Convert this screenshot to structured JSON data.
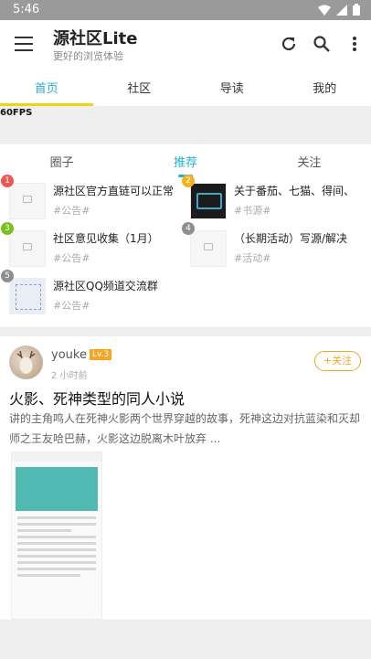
{
  "statusbar": {
    "time": "5:46",
    "icons": [
      "wifi-icon",
      "signal-icon",
      "battery-icon"
    ]
  },
  "appbar": {
    "title": "源社区Lite",
    "subtitle": "更好的浏览体验",
    "actions": [
      "refresh-icon",
      "search-icon",
      "more-vertical-icon"
    ]
  },
  "tabs": [
    {
      "label": "首页",
      "active": true
    },
    {
      "label": "社区",
      "active": false
    },
    {
      "label": "导读",
      "active": false
    },
    {
      "label": "我的",
      "active": false
    }
  ],
  "fps": "60FPS",
  "subtabs": [
    {
      "label": "圈子",
      "active": false
    },
    {
      "label": "推荐",
      "active": true
    },
    {
      "label": "关注",
      "active": false
    }
  ],
  "recommend": [
    {
      "rank": "1",
      "title": "源社区官方直链可以正常",
      "tag": "#公告#"
    },
    {
      "rank": "2",
      "title": "关于番茄、七猫、得间、",
      "tag": "#书源#"
    },
    {
      "rank": "3",
      "title": "社区意见收集（1月）",
      "tag": "#公告#"
    },
    {
      "rank": "4",
      "title": "（长期活动）写源/解决",
      "tag": "#活动#"
    },
    {
      "rank": "5",
      "title": "源社区QQ频道交流群",
      "tag": "#公告#"
    }
  ],
  "post": {
    "username": "youke",
    "level": "Lv.3",
    "time": "2 小时前",
    "follow_label": "+关注",
    "title": "火影、死神类型的同人小说",
    "body": "讲的主角鸣人在死神火影两个世界穿越的故事，死神这边对抗蓝染和灭却师之王友哈巴赫，火影这边脱离木叶放弃 ..."
  },
  "colors": {
    "accent": "#27b1cf",
    "tab_indicator": "#f5d20f",
    "level_badge": "#f5a623"
  }
}
